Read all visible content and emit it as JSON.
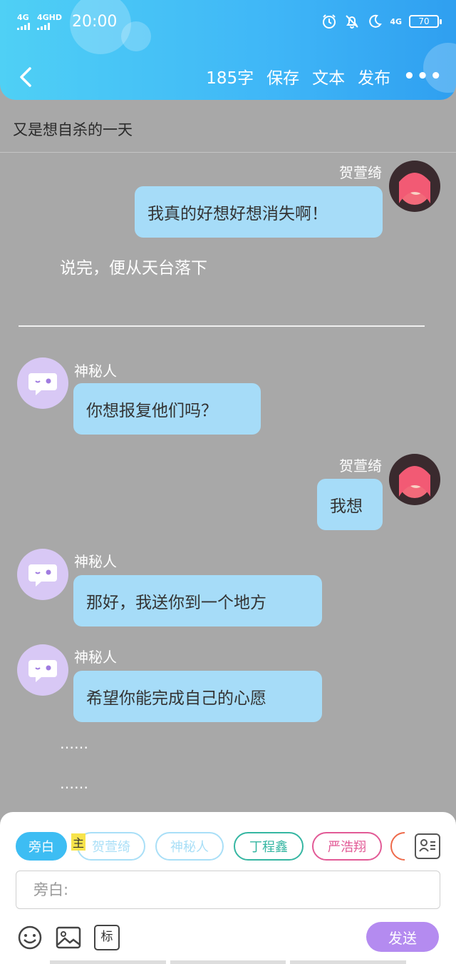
{
  "status_bar": {
    "signal1": "4G",
    "signal2": "4GHD",
    "time": "20:00",
    "network": "4G",
    "battery": "70"
  },
  "nav": {
    "word_count": "185字",
    "save": "保存",
    "text": "文本",
    "publish": "发布",
    "more": "•••"
  },
  "story_title": "又是想自杀的一天",
  "messages": {
    "m1": {
      "name": "贺萱绮",
      "text": "我真的好想好想消失啊！"
    },
    "narration1": "说完，便从天台落下",
    "m2": {
      "name": "神秘人",
      "text": "你想报复他们吗？"
    },
    "m3": {
      "name": "贺萱绮",
      "text": "我想"
    },
    "m4": {
      "name": "神秘人",
      "text": "那好，我送你到一个地方"
    },
    "m5": {
      "name": "神秘人",
      "text": "希望你能完成自己的心愿"
    },
    "ellipsis1": "……",
    "ellipsis2": "……"
  },
  "panel": {
    "chips": [
      "旁白",
      "贺萱绮",
      "神秘人",
      "丁程鑫",
      "严浩翔"
    ],
    "main_tag": "主",
    "input_placeholder": "旁白:",
    "tag_tool": "标",
    "send": "发送"
  },
  "colors": {
    "header_start": "#4fd0f5",
    "header_end": "#2f9ff0",
    "bubble": "#a6dcf8",
    "send": "#b48bf0",
    "chip_active": "#3dbdf3"
  }
}
